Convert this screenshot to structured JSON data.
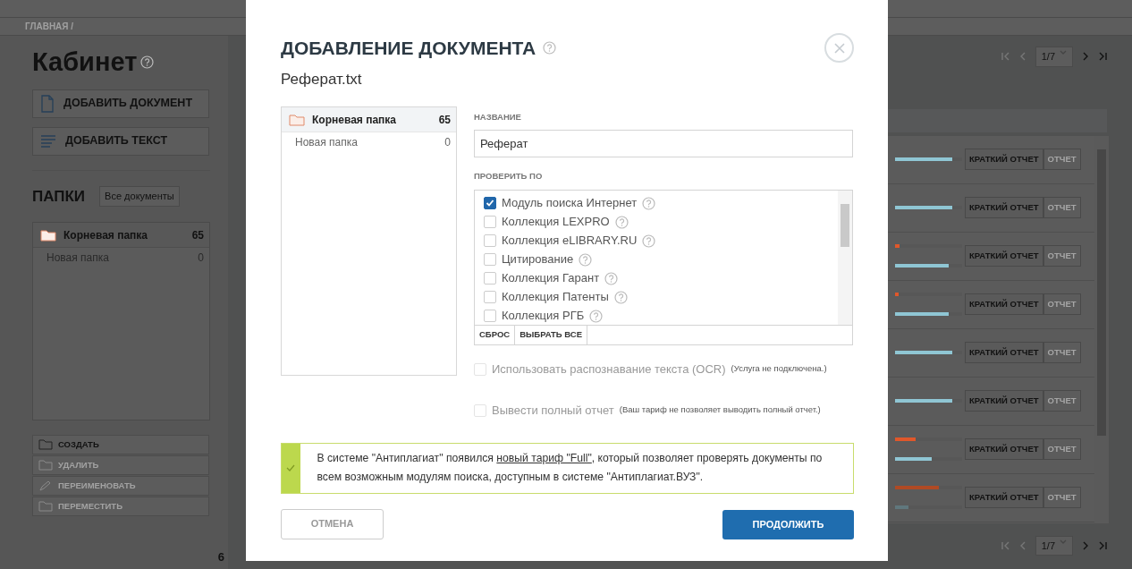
{
  "page": {
    "breadcrumb": "ГЛАВНАЯ /",
    "title": "Кабинет",
    "actions": [
      {
        "label": "ДОБАВИТЬ ДОКУМЕНТ",
        "kind": "document"
      },
      {
        "label": "ДОБАВИТЬ ТЕКСТ",
        "kind": "text"
      }
    ],
    "folders_heading": "ПАПКИ",
    "all_documents": "Все документы",
    "folders": [
      {
        "name": "Корневая папка",
        "count": "65",
        "selected": true
      },
      {
        "name": "Новая папка",
        "count": "0",
        "selected": false
      }
    ],
    "folder_actions": [
      {
        "label": "СОЗДАТЬ",
        "kind": "create",
        "disabled": false
      },
      {
        "label": "УДАЛИТЬ",
        "kind": "delete",
        "disabled": true
      },
      {
        "label": "ПЕРЕИМЕНОВАТЬ",
        "kind": "rename",
        "disabled": true
      },
      {
        "label": "ПЕРЕМЕСТИТЬ",
        "kind": "move",
        "disabled": true
      }
    ],
    "footer_count": "6",
    "pagination_top": {
      "page": "1/7",
      "back_disabled": true,
      "forward_disabled": false
    },
    "pagination_bottom": {
      "page": "1/7",
      "back_disabled": true,
      "forward_disabled": false
    },
    "rows": [
      {
        "indicators": [
          {
            "color": "#8fc6d4",
            "level": 0.85
          }
        ],
        "buttons": [
          {
            "label": "КРАТКИЙ ОТЧЕТ",
            "disabled": false
          },
          {
            "label": "ОТЧЕТ",
            "disabled": true
          }
        ]
      },
      {
        "indicators": [
          {
            "color": "#8fc6d4",
            "level": 0.85
          }
        ],
        "buttons": [
          {
            "label": "КРАТКИЙ ОТЧЕТ",
            "disabled": false
          },
          {
            "label": "ОТЧЕТ",
            "disabled": true
          }
        ]
      },
      {
        "indicators": [
          {
            "color": "#e0572a",
            "level": 0.07
          },
          {
            "color": "#8fc6d4",
            "level": 0.8
          }
        ],
        "buttons": [
          {
            "label": "КРАТКИЙ ОТЧЕТ",
            "disabled": false
          },
          {
            "label": "ОТЧЕТ",
            "disabled": true
          }
        ]
      },
      {
        "indicators": [
          {
            "color": "#e0572a",
            "level": 0.05
          },
          {
            "color": "#8fc6d4",
            "level": 0.8
          }
        ],
        "buttons": [
          {
            "label": "КРАТКИЙ ОТЧЕТ",
            "disabled": false
          },
          {
            "label": "ОТЧЕТ",
            "disabled": true
          }
        ]
      },
      {
        "indicators": [
          {
            "color": "#8fc6d4",
            "level": 0.85
          }
        ],
        "buttons": [
          {
            "label": "КРАТКИЙ ОТЧЕТ",
            "disabled": false
          },
          {
            "label": "ОТЧЕТ",
            "disabled": true
          }
        ]
      },
      {
        "indicators": [
          {
            "color": "#8fc6d4",
            "level": 0.85
          }
        ],
        "buttons": [
          {
            "label": "КРАТКИЙ ОТЧЕТ",
            "disabled": false
          },
          {
            "label": "ОТЧЕТ",
            "disabled": true
          }
        ]
      },
      {
        "indicators": [
          {
            "color": "#e0572a",
            "level": 0.3
          },
          {
            "color": "#8fc6d4",
            "level": 0.55
          }
        ],
        "buttons": [
          {
            "label": "КРАТКИЙ ОТЧЕТ",
            "disabled": false
          },
          {
            "label": "ОТЧЕТ",
            "disabled": true
          }
        ]
      },
      {
        "indicators": [
          {
            "color": "#b04a24",
            "level": 0.65
          },
          {
            "color": "#60777d",
            "level": 0.2
          }
        ],
        "buttons": [
          {
            "label": "КРАТКИЙ ОТЧЕТ",
            "disabled": false
          },
          {
            "label": "ОТЧЕТ",
            "disabled": true
          }
        ]
      }
    ]
  },
  "modal": {
    "title": "ДОБАВЛЕНИЕ ДОКУМЕНТА",
    "file_name": "Реферат.txt",
    "folders": [
      {
        "name": "Корневая папка",
        "count": "65",
        "selected": true
      },
      {
        "name": "Новая папка",
        "count": "0",
        "selected": false
      }
    ],
    "name_label": "НАЗВАНИЕ",
    "name_value": "Реферат",
    "check_label": "ПРОВЕРИТЬ ПО",
    "sources": [
      {
        "label": "Модуль поиска Интернет",
        "checked": true
      },
      {
        "label": "Коллекция LEXPRO",
        "checked": false
      },
      {
        "label": "Коллекция eLIBRARY.RU",
        "checked": false
      },
      {
        "label": "Цитирование",
        "checked": false
      },
      {
        "label": "Коллекция Гарант",
        "checked": false
      },
      {
        "label": "Коллекция Патенты",
        "checked": false
      },
      {
        "label": "Коллекция РГБ",
        "checked": false
      }
    ],
    "reset": "СБРОС",
    "select_all": "ВЫБРАТЬ ВСЕ",
    "options": [
      {
        "label": "Использовать распознавание текста (OCR)",
        "note": "(Услуга не подключена.)",
        "checked": false,
        "disabled": true
      },
      {
        "label": "Вывести полный отчет",
        "note": "(Ваш тариф не позволяет выводить полный отчет.)",
        "checked": false,
        "disabled": true
      }
    ],
    "notice": {
      "before": "В системе \"Антиплагиат\" появился ",
      "link": "новый тариф \"Full\"",
      "after": ", который позволяет проверять документы по всем возможным модулям поиска, доступным в системе \"Антиплагиат.ВУЗ\"."
    },
    "cancel": "ОТМЕНА",
    "continue": "ПРОДОЛЖИТЬ"
  }
}
